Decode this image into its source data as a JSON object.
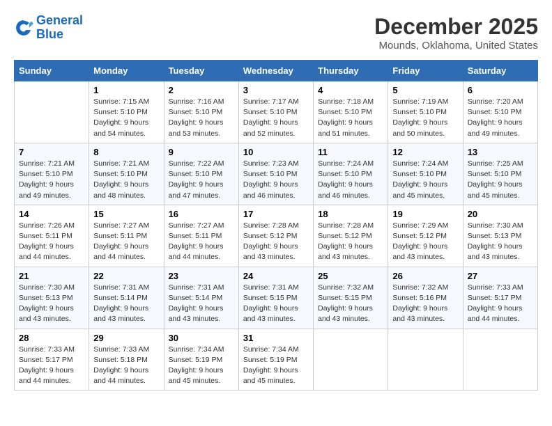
{
  "logo": {
    "line1": "General",
    "line2": "Blue"
  },
  "title": "December 2025",
  "subtitle": "Mounds, Oklahoma, United States",
  "days_of_week": [
    "Sunday",
    "Monday",
    "Tuesday",
    "Wednesday",
    "Thursday",
    "Friday",
    "Saturday"
  ],
  "weeks": [
    [
      {
        "day": "",
        "info": ""
      },
      {
        "day": "1",
        "info": "Sunrise: 7:15 AM\nSunset: 5:10 PM\nDaylight: 9 hours\nand 54 minutes."
      },
      {
        "day": "2",
        "info": "Sunrise: 7:16 AM\nSunset: 5:10 PM\nDaylight: 9 hours\nand 53 minutes."
      },
      {
        "day": "3",
        "info": "Sunrise: 7:17 AM\nSunset: 5:10 PM\nDaylight: 9 hours\nand 52 minutes."
      },
      {
        "day": "4",
        "info": "Sunrise: 7:18 AM\nSunset: 5:10 PM\nDaylight: 9 hours\nand 51 minutes."
      },
      {
        "day": "5",
        "info": "Sunrise: 7:19 AM\nSunset: 5:10 PM\nDaylight: 9 hours\nand 50 minutes."
      },
      {
        "day": "6",
        "info": "Sunrise: 7:20 AM\nSunset: 5:10 PM\nDaylight: 9 hours\nand 49 minutes."
      }
    ],
    [
      {
        "day": "7",
        "info": "Sunrise: 7:21 AM\nSunset: 5:10 PM\nDaylight: 9 hours\nand 49 minutes."
      },
      {
        "day": "8",
        "info": "Sunrise: 7:21 AM\nSunset: 5:10 PM\nDaylight: 9 hours\nand 48 minutes."
      },
      {
        "day": "9",
        "info": "Sunrise: 7:22 AM\nSunset: 5:10 PM\nDaylight: 9 hours\nand 47 minutes."
      },
      {
        "day": "10",
        "info": "Sunrise: 7:23 AM\nSunset: 5:10 PM\nDaylight: 9 hours\nand 46 minutes."
      },
      {
        "day": "11",
        "info": "Sunrise: 7:24 AM\nSunset: 5:10 PM\nDaylight: 9 hours\nand 46 minutes."
      },
      {
        "day": "12",
        "info": "Sunrise: 7:24 AM\nSunset: 5:10 PM\nDaylight: 9 hours\nand 45 minutes."
      },
      {
        "day": "13",
        "info": "Sunrise: 7:25 AM\nSunset: 5:10 PM\nDaylight: 9 hours\nand 45 minutes."
      }
    ],
    [
      {
        "day": "14",
        "info": "Sunrise: 7:26 AM\nSunset: 5:11 PM\nDaylight: 9 hours\nand 44 minutes."
      },
      {
        "day": "15",
        "info": "Sunrise: 7:27 AM\nSunset: 5:11 PM\nDaylight: 9 hours\nand 44 minutes."
      },
      {
        "day": "16",
        "info": "Sunrise: 7:27 AM\nSunset: 5:11 PM\nDaylight: 9 hours\nand 44 minutes."
      },
      {
        "day": "17",
        "info": "Sunrise: 7:28 AM\nSunset: 5:12 PM\nDaylight: 9 hours\nand 43 minutes."
      },
      {
        "day": "18",
        "info": "Sunrise: 7:28 AM\nSunset: 5:12 PM\nDaylight: 9 hours\nand 43 minutes."
      },
      {
        "day": "19",
        "info": "Sunrise: 7:29 AM\nSunset: 5:12 PM\nDaylight: 9 hours\nand 43 minutes."
      },
      {
        "day": "20",
        "info": "Sunrise: 7:30 AM\nSunset: 5:13 PM\nDaylight: 9 hours\nand 43 minutes."
      }
    ],
    [
      {
        "day": "21",
        "info": "Sunrise: 7:30 AM\nSunset: 5:13 PM\nDaylight: 9 hours\nand 43 minutes."
      },
      {
        "day": "22",
        "info": "Sunrise: 7:31 AM\nSunset: 5:14 PM\nDaylight: 9 hours\nand 43 minutes."
      },
      {
        "day": "23",
        "info": "Sunrise: 7:31 AM\nSunset: 5:14 PM\nDaylight: 9 hours\nand 43 minutes."
      },
      {
        "day": "24",
        "info": "Sunrise: 7:31 AM\nSunset: 5:15 PM\nDaylight: 9 hours\nand 43 minutes."
      },
      {
        "day": "25",
        "info": "Sunrise: 7:32 AM\nSunset: 5:15 PM\nDaylight: 9 hours\nand 43 minutes."
      },
      {
        "day": "26",
        "info": "Sunrise: 7:32 AM\nSunset: 5:16 PM\nDaylight: 9 hours\nand 43 minutes."
      },
      {
        "day": "27",
        "info": "Sunrise: 7:33 AM\nSunset: 5:17 PM\nDaylight: 9 hours\nand 44 minutes."
      }
    ],
    [
      {
        "day": "28",
        "info": "Sunrise: 7:33 AM\nSunset: 5:17 PM\nDaylight: 9 hours\nand 44 minutes."
      },
      {
        "day": "29",
        "info": "Sunrise: 7:33 AM\nSunset: 5:18 PM\nDaylight: 9 hours\nand 44 minutes."
      },
      {
        "day": "30",
        "info": "Sunrise: 7:34 AM\nSunset: 5:19 PM\nDaylight: 9 hours\nand 45 minutes."
      },
      {
        "day": "31",
        "info": "Sunrise: 7:34 AM\nSunset: 5:19 PM\nDaylight: 9 hours\nand 45 minutes."
      },
      {
        "day": "",
        "info": ""
      },
      {
        "day": "",
        "info": ""
      },
      {
        "day": "",
        "info": ""
      }
    ]
  ]
}
